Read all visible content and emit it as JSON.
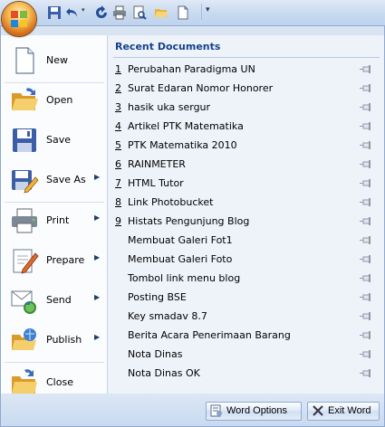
{
  "menu": {
    "items": [
      {
        "label": "New",
        "icon": "new-document-icon",
        "has_submenu": false
      },
      {
        "label": "Open",
        "icon": "open-folder-icon",
        "has_submenu": false
      },
      {
        "label": "Save",
        "icon": "save-disk-icon",
        "has_submenu": false
      },
      {
        "label": "Save As",
        "icon": "save-as-icon",
        "has_submenu": true
      },
      {
        "label": "Print",
        "icon": "printer-icon",
        "has_submenu": true
      },
      {
        "label": "Prepare",
        "icon": "prepare-icon",
        "has_submenu": true
      },
      {
        "label": "Send",
        "icon": "send-icon",
        "has_submenu": true
      },
      {
        "label": "Publish",
        "icon": "publish-icon",
        "has_submenu": true
      },
      {
        "label": "Close",
        "icon": "close-folder-icon",
        "has_submenu": false
      }
    ],
    "submenu_arrow": "▶"
  },
  "recent": {
    "title": "Recent Documents",
    "documents": [
      {
        "num": "1",
        "name": "Perubahan Paradigma UN"
      },
      {
        "num": "2",
        "name": "Surat Edaran Nomor Honorer"
      },
      {
        "num": "3",
        "name": "hasik uka sergur"
      },
      {
        "num": "4",
        "name": "Artikel PTK Matematika"
      },
      {
        "num": "5",
        "name": "PTK Matematika 2010"
      },
      {
        "num": "6",
        "name": "RAINMETER"
      },
      {
        "num": "7",
        "name": "HTML Tutor"
      },
      {
        "num": "8",
        "name": "Link Photobucket"
      },
      {
        "num": "9",
        "name": "Histats Pengunjung Blog"
      },
      {
        "num": "",
        "name": "Membuat Galeri Fot1"
      },
      {
        "num": "",
        "name": "Membuat Galeri Foto"
      },
      {
        "num": "",
        "name": "Tombol  link menu blog"
      },
      {
        "num": "",
        "name": "Posting BSE"
      },
      {
        "num": "",
        "name": "Key smadav 8.7"
      },
      {
        "num": "",
        "name": "Berita Acara Penerimaan Barang"
      },
      {
        "num": "",
        "name": "Nota Dinas"
      },
      {
        "num": "",
        "name": "Nota Dinas OK"
      }
    ]
  },
  "footer": {
    "word_options_label": "Word Options",
    "exit_word_label": "Exit Word"
  },
  "colors": {
    "accent": "#15428b",
    "pane": "#eef3fa",
    "frame": "#8ea8cf"
  }
}
